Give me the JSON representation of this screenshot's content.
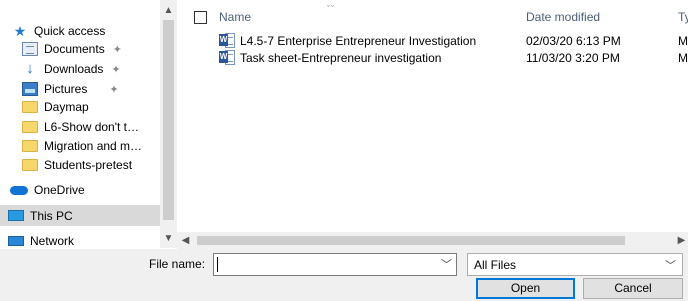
{
  "nav": {
    "items": [
      {
        "label": "Quick access",
        "icon": "star-icon",
        "pinned": false
      },
      {
        "label": "Documents",
        "icon": "documents-icon",
        "pinned": true
      },
      {
        "label": "Downloads",
        "icon": "downloads-icon",
        "pinned": true
      },
      {
        "label": "Pictures",
        "icon": "pictures-icon",
        "pinned": true
      },
      {
        "label": "Daymap",
        "icon": "folder-icon",
        "pinned": false
      },
      {
        "label": "L6-Show don't t…",
        "icon": "folder-icon",
        "pinned": false
      },
      {
        "label": "Migration and m…",
        "icon": "folder-icon",
        "pinned": false
      },
      {
        "label": "Students-pretest",
        "icon": "folder-icon",
        "pinned": false
      },
      {
        "label": "OneDrive",
        "icon": "onedrive-icon",
        "pinned": false
      },
      {
        "label": "This PC",
        "icon": "this-pc-icon",
        "pinned": false,
        "selected": true
      },
      {
        "label": "Network",
        "icon": "network-icon",
        "pinned": false
      }
    ],
    "pin_glyph": "★"
  },
  "columns": {
    "name": "Name",
    "date": "Date modified",
    "type": "Ty"
  },
  "files": [
    {
      "name": "L4.5-7 Enterprise Entrepreneur Investigation",
      "date": "02/03/20 6:13 PM",
      "type": "M"
    },
    {
      "name": "Task sheet-Entrepreneur investigation",
      "date": "11/03/20 3:20 PM",
      "type": "M"
    }
  ],
  "bottom": {
    "file_name_label": "File name:",
    "file_name_value": "",
    "file_type": "All Files",
    "open_label": "Open",
    "cancel_label": "Cancel"
  },
  "colors": {
    "accent": "#0078d7",
    "header_text": "#4c607a",
    "word_blue": "#2b579a"
  }
}
